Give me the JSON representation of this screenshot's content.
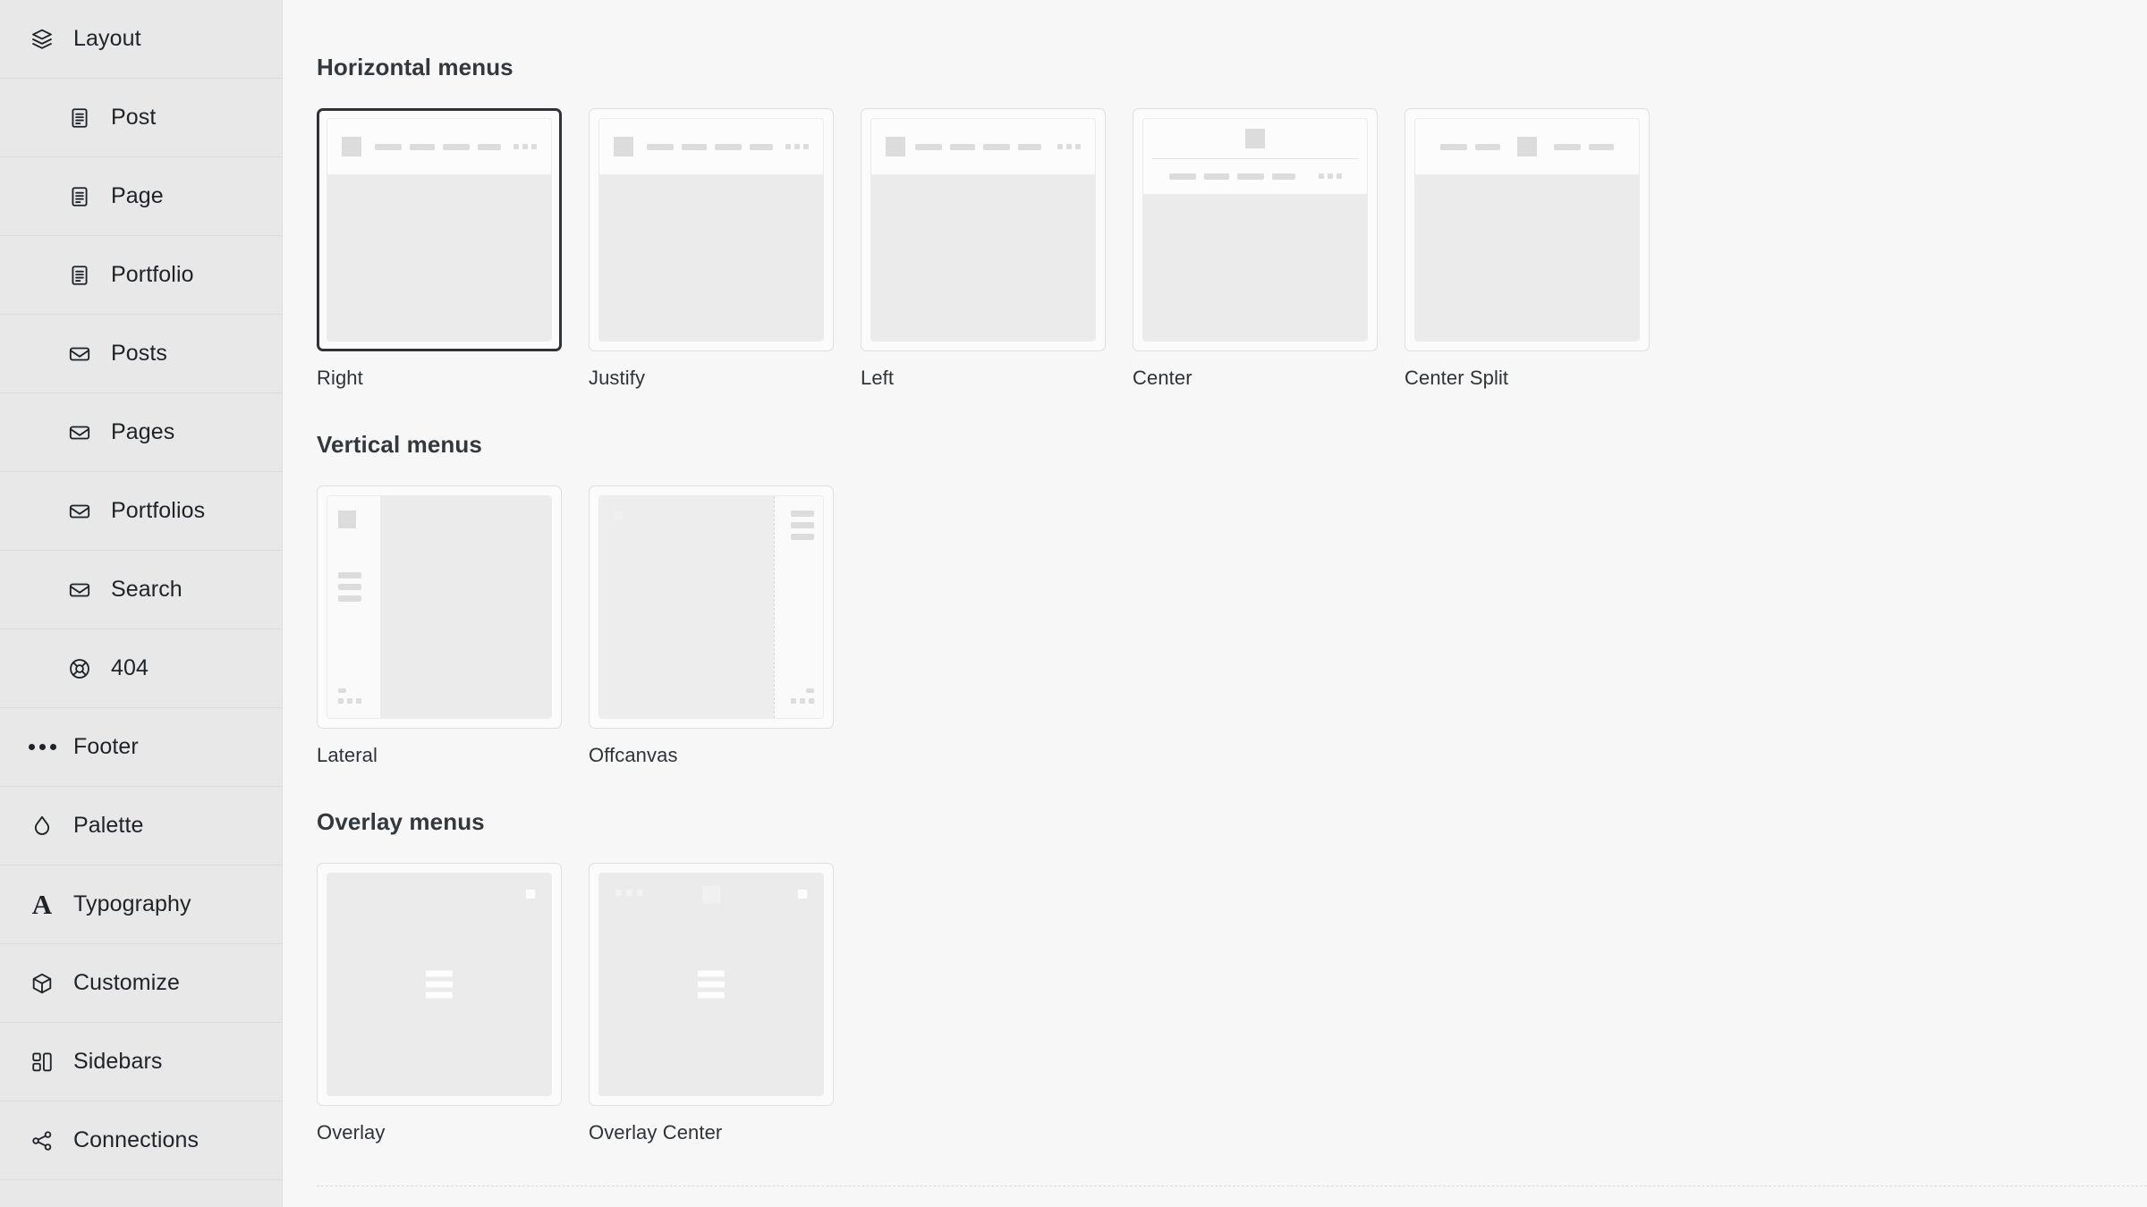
{
  "sidebar": {
    "items": [
      {
        "label": "Layout",
        "icon": "layers-icon",
        "level": "root"
      },
      {
        "label": "Post",
        "icon": "document-icon",
        "level": "child"
      },
      {
        "label": "Page",
        "icon": "document-icon",
        "level": "child"
      },
      {
        "label": "Portfolio",
        "icon": "document-icon",
        "level": "child"
      },
      {
        "label": "Posts",
        "icon": "envelope-icon",
        "level": "child"
      },
      {
        "label": "Pages",
        "icon": "envelope-icon",
        "level": "child"
      },
      {
        "label": "Portfolios",
        "icon": "envelope-icon",
        "level": "child"
      },
      {
        "label": "Search",
        "icon": "envelope-icon",
        "level": "child"
      },
      {
        "label": "404",
        "icon": "lifebuoy-icon",
        "level": "child"
      },
      {
        "label": "Footer",
        "icon": "dots-icon",
        "level": "root"
      },
      {
        "label": "Palette",
        "icon": "droplet-icon",
        "level": "root"
      },
      {
        "label": "Typography",
        "icon": "letter-a-icon",
        "level": "root"
      },
      {
        "label": "Customize",
        "icon": "cube-icon",
        "level": "root"
      },
      {
        "label": "Sidebars",
        "icon": "panels-icon",
        "level": "root"
      },
      {
        "label": "Connections",
        "icon": "share-icon",
        "level": "root"
      }
    ]
  },
  "main": {
    "sections": [
      {
        "title": "Horizontal menus",
        "cards": [
          {
            "label": "Right",
            "variant": "right",
            "selected": true
          },
          {
            "label": "Justify",
            "variant": "justify",
            "selected": false
          },
          {
            "label": "Left",
            "variant": "left",
            "selected": false
          },
          {
            "label": "Center",
            "variant": "center",
            "selected": false
          },
          {
            "label": "Center Split",
            "variant": "center-split",
            "selected": false
          }
        ]
      },
      {
        "title": "Vertical menus",
        "cards": [
          {
            "label": "Lateral",
            "variant": "lateral",
            "selected": false
          },
          {
            "label": "Offcanvas",
            "variant": "offcanvas",
            "selected": false
          }
        ]
      },
      {
        "title": "Overlay menus",
        "cards": [
          {
            "label": "Overlay",
            "variant": "overlay",
            "selected": false
          },
          {
            "label": "Overlay Center",
            "variant": "overlay-center",
            "selected": false
          }
        ]
      }
    ]
  },
  "colors": {
    "sidebar_bg": "#e8e8e8",
    "main_bg": "#f7f7f7",
    "text": "#1f2328",
    "selected_border": "#2f3338",
    "placeholder_bar": "#dcdcdc"
  }
}
